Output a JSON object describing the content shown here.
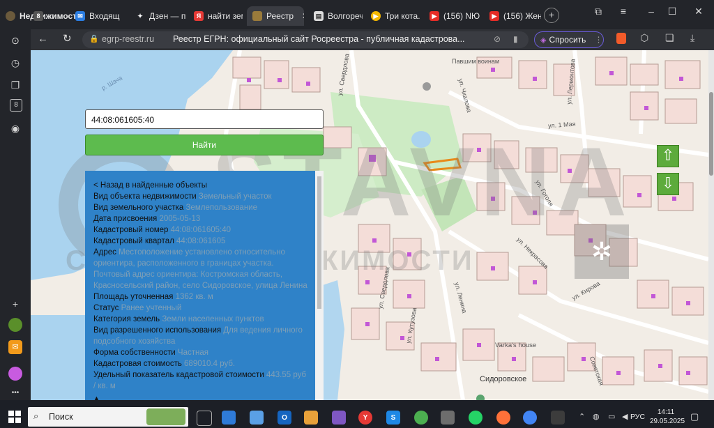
{
  "browser": {
    "tabs": [
      {
        "label": "Недвижимость",
        "icon": "home-icon"
      },
      {
        "label": "8",
        "icon": "counter-badge"
      },
      {
        "label": "Входящ",
        "icon": "mail-icon"
      },
      {
        "label": "Дзен — п",
        "icon": "zen-icon"
      },
      {
        "label": "найти зем",
        "icon": "yandex-icon"
      },
      {
        "label": "Реестр",
        "icon": "emblem-icon"
      },
      {
        "label": "Волгореч",
        "icon": "doc-icon"
      },
      {
        "label": "Три кота.",
        "icon": "play-icon"
      },
      {
        "label": "(156) NЮ",
        "icon": "youtube-icon"
      },
      {
        "label": "(156) Жен",
        "icon": "youtube-icon"
      }
    ],
    "active_tab_index": 5,
    "url": "egrp-reestr.ru",
    "page_title": "Реестр ЕГРН: официальный сайт Росреестра - публичная кадастрова...",
    "ask_button": "Спросить"
  },
  "search": {
    "value": "44:08:061605:40",
    "button": "Найти"
  },
  "panel": {
    "back_link": "< Назад в найденные объекты",
    "fields": [
      {
        "key": "Вид объекта недвижимости",
        "value": "Земельный участок"
      },
      {
        "key": "Вид земельного участка",
        "value": "Землепользование"
      },
      {
        "key": "Дата присвоения",
        "value": "2005-05-13"
      },
      {
        "key": "Кадастровый номер",
        "value": "44:08:061605:40"
      },
      {
        "key": "Кадастровый квартал",
        "value": "44:08:061605"
      },
      {
        "key": "Адрес",
        "value": "Местоположение установлено относительно ориентира, расположенного в границах участка. Почтовый адрес ориентира: Костромская область, Красносельский район, село Сидоровское, улица Ленина"
      },
      {
        "key": "Площадь уточненная",
        "value": "1362 кв. м"
      },
      {
        "key": "Статус",
        "value": "Ранее учтенный"
      },
      {
        "key": "Категория земель",
        "value": "Земли населенных пунктов"
      },
      {
        "key": "Вид разрешенного использования",
        "value": "Для ведения личного подсобного хозяйства"
      },
      {
        "key": "Форма собственности",
        "value": "Частная"
      },
      {
        "key": "Кадастровая стоимость",
        "value": "689010.4 руб."
      },
      {
        "key": "Удельный показатель кадастровой стоимости",
        "value": "443.55 руб / кв. м"
      }
    ]
  },
  "map": {
    "labels": {
      "memorial": "Павшим воинам",
      "may1": "ул. 1 Мая",
      "gogol": "ул. Гоголя",
      "nekrasov": "ул. Некрасова",
      "kirov": "ул. Кирова",
      "lenin": "ул. Ленина",
      "kutuzov": "ул. Кутузова",
      "sverdlov": "ул. Свердлова",
      "sverdlov2": "ул. Свердлова",
      "lermontov": "ул. Лермонтова",
      "sovetskaya": "Советская",
      "chkalov": "ул. Чкалова",
      "varka": "Varka's house",
      "village": "Сидоровское",
      "shalva": "р. Шача"
    },
    "watermark": {
      "brand": "STAVNA",
      "sub": "СТАВНА НЕДВИЖИМОСТИ"
    },
    "nav": {
      "up": "⇧",
      "down": "⇩"
    }
  },
  "taskbar": {
    "search": "Поиск",
    "time": "14:11",
    "date": "29.05.2025",
    "lang": "РУС"
  }
}
